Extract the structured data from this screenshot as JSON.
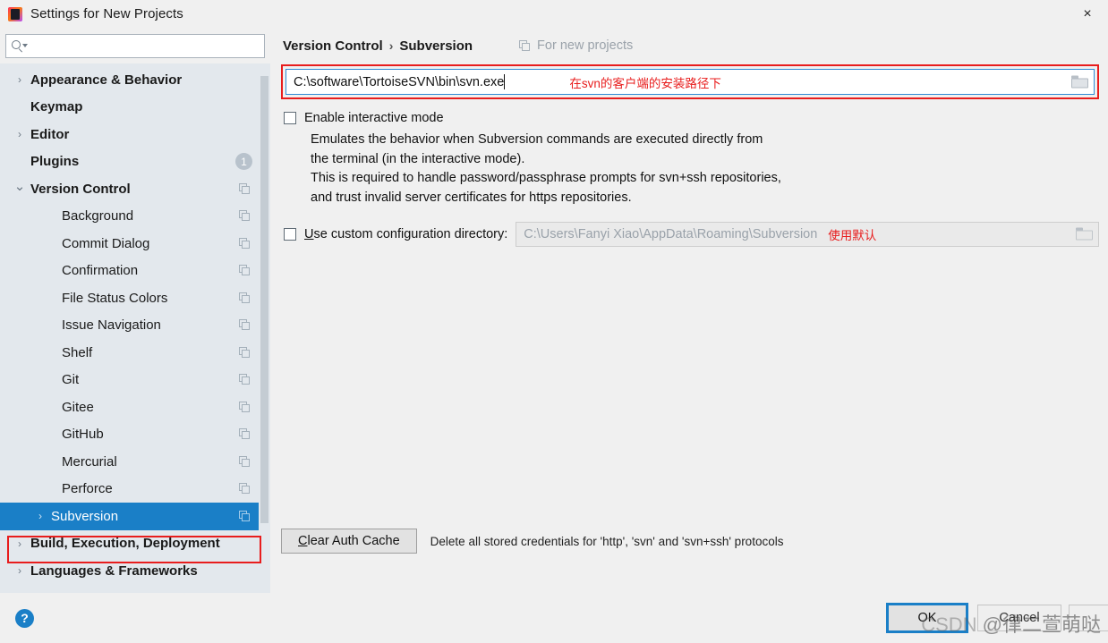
{
  "window": {
    "title": "Settings for New Projects",
    "app_icon": "intellij-idea-icon",
    "close_label": "×"
  },
  "search": {
    "value": "",
    "placeholder": "",
    "icon": "search-icon"
  },
  "sidebar": {
    "items": [
      {
        "label": "Appearance & Behavior",
        "level": "top",
        "arrow": "›",
        "badge": null,
        "copy": false,
        "selected": false
      },
      {
        "label": "Keymap",
        "level": "top",
        "arrow": "",
        "badge": null,
        "copy": false,
        "selected": false
      },
      {
        "label": "Editor",
        "level": "top",
        "arrow": "›",
        "badge": null,
        "copy": false,
        "selected": false
      },
      {
        "label": "Plugins",
        "level": "top",
        "arrow": "",
        "badge": "1",
        "copy": false,
        "selected": false
      },
      {
        "label": "Version Control",
        "level": "top",
        "arrow": "⌄",
        "badge": null,
        "copy": true,
        "selected": false
      },
      {
        "label": "Background",
        "level": "child",
        "arrow": "",
        "badge": null,
        "copy": true,
        "selected": false
      },
      {
        "label": "Commit Dialog",
        "level": "child",
        "arrow": "",
        "badge": null,
        "copy": true,
        "selected": false
      },
      {
        "label": "Confirmation",
        "level": "child",
        "arrow": "",
        "badge": null,
        "copy": true,
        "selected": false
      },
      {
        "label": "File Status Colors",
        "level": "child",
        "arrow": "",
        "badge": null,
        "copy": true,
        "selected": false
      },
      {
        "label": "Issue Navigation",
        "level": "child",
        "arrow": "",
        "badge": null,
        "copy": true,
        "selected": false
      },
      {
        "label": "Shelf",
        "level": "child",
        "arrow": "",
        "badge": null,
        "copy": true,
        "selected": false
      },
      {
        "label": "Git",
        "level": "child",
        "arrow": "",
        "badge": null,
        "copy": true,
        "selected": false
      },
      {
        "label": "Gitee",
        "level": "child",
        "arrow": "",
        "badge": null,
        "copy": true,
        "selected": false
      },
      {
        "label": "GitHub",
        "level": "child",
        "arrow": "",
        "badge": null,
        "copy": true,
        "selected": false
      },
      {
        "label": "Mercurial",
        "level": "child",
        "arrow": "",
        "badge": null,
        "copy": true,
        "selected": false
      },
      {
        "label": "Perforce",
        "level": "child",
        "arrow": "",
        "badge": null,
        "copy": true,
        "selected": false
      },
      {
        "label": "Subversion",
        "level": "child-expandable",
        "arrow": "›",
        "badge": null,
        "copy": true,
        "selected": true
      },
      {
        "label": "Build, Execution, Deployment",
        "level": "top",
        "arrow": "›",
        "badge": null,
        "copy": false,
        "selected": false
      },
      {
        "label": "Languages & Frameworks",
        "level": "top",
        "arrow": "›",
        "badge": null,
        "copy": false,
        "selected": false
      }
    ]
  },
  "content": {
    "breadcrumb": {
      "parent": "Version Control",
      "separator": "›",
      "current": "Subversion"
    },
    "scope_label": "For new projects",
    "path_field": {
      "value": "C:\\software\\TortoiseSVN\\bin\\svn.exe",
      "annotation": "在svn的客户端的安装路径下",
      "browse_icon": "folder-icon"
    },
    "interactive_mode": {
      "label": "Enable interactive mode",
      "checked": false,
      "description": [
        "Emulates the behavior when Subversion commands are executed directly from",
        "the terminal (in the interactive mode).",
        "This is required to handle password/passphrase prompts for svn+ssh repositories,",
        "and trust invalid server certificates for https repositories."
      ]
    },
    "custom_config": {
      "label_mnemonic": "U",
      "label_rest": "se custom configuration directory:",
      "checked": false,
      "value": "C:\\Users\\Fanyi Xiao\\AppData\\Roaming\\Subversion",
      "annotation": "使用默认",
      "browse_icon": "folder-icon"
    },
    "clear_auth": {
      "mnemonic": "C",
      "label_rest": "lear Auth Cache",
      "description": "Delete all stored credentials for 'http', 'svn' and 'svn+ssh' protocols"
    }
  },
  "footer": {
    "help_label": "?",
    "ok_label": "OK",
    "cancel_label": "Cancel",
    "apply_label": ""
  },
  "watermark": {
    "prefix": "CSDN ",
    "handle": "@律二萱萌哒"
  },
  "colors": {
    "accent": "#1a7fc7",
    "annotation_red": "#e81d1d",
    "sidebar_bg": "#e3e8ed",
    "dialog_bg": "#f0f0f0"
  }
}
